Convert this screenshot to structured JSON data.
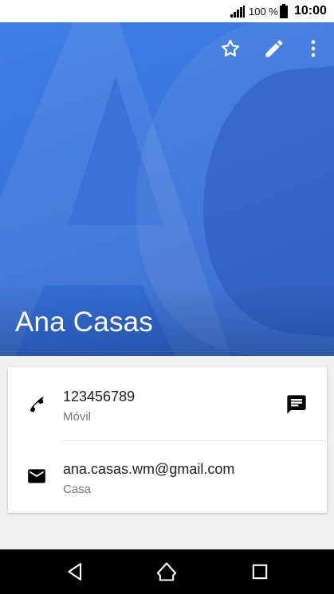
{
  "status_bar": {
    "battery_text": "100 %",
    "time": "10:00",
    "signal_icon": "signal-icon",
    "battery_icon": "battery-full-icon"
  },
  "header": {
    "contact_name": "Ana Casas",
    "background_color": "#3a78e0",
    "actions": [
      {
        "icon": "star-outline-icon",
        "label": "Favorite"
      },
      {
        "icon": "edit-pencil-icon",
        "label": "Edit"
      },
      {
        "icon": "more-vert-icon",
        "label": "More options"
      }
    ]
  },
  "contact_card": {
    "phone": {
      "number": "123456789",
      "type": "Móvil",
      "icon": "phone-icon",
      "action_icon": "message-icon"
    },
    "email": {
      "address": "ana.casas.wm@gmail.com",
      "type": "Casa",
      "icon": "email-icon"
    }
  },
  "nav_bar": {
    "buttons": [
      {
        "icon": "back-icon"
      },
      {
        "icon": "home-icon"
      },
      {
        "icon": "recents-icon"
      }
    ]
  }
}
